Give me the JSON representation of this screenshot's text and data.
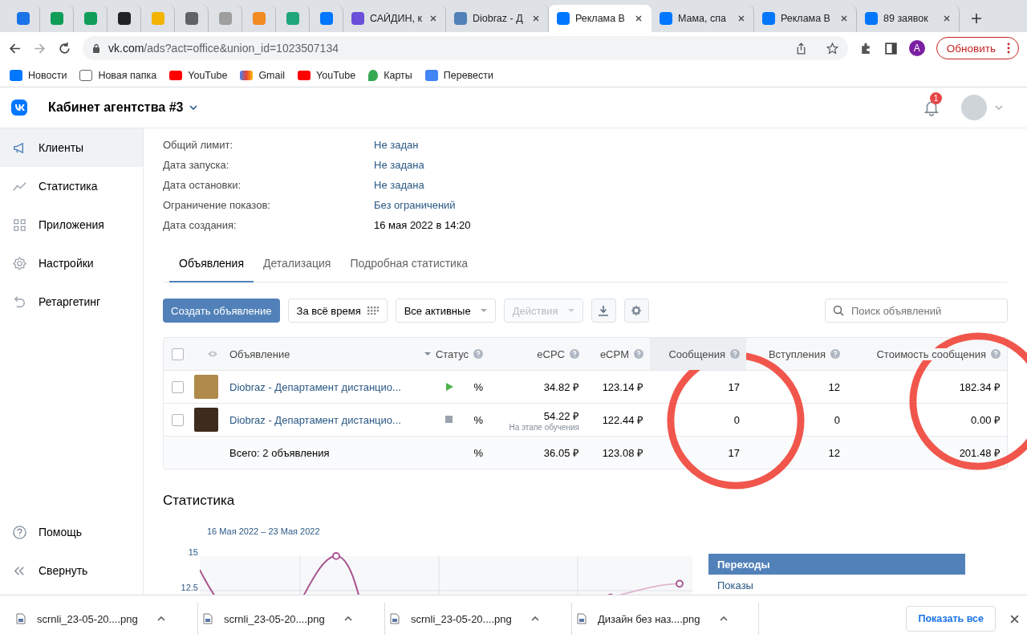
{
  "browser": {
    "tabs": [
      {
        "kind": "icon",
        "color": "#1a73e8",
        "selected": false
      },
      {
        "kind": "icon",
        "color": "#0f9d58",
        "selected": false
      },
      {
        "kind": "icon",
        "color": "#0f9d58",
        "selected": false
      },
      {
        "kind": "icon",
        "color": "#202124",
        "selected": false
      },
      {
        "kind": "icon",
        "color": "#f2b400",
        "selected": false
      },
      {
        "kind": "icon",
        "color": "#5f6368",
        "selected": false
      },
      {
        "kind": "icon",
        "color": "#9e9e9e",
        "selected": false
      },
      {
        "kind": "icon",
        "color": "#f28b22",
        "selected": false
      },
      {
        "kind": "icon",
        "color": "#1fa67a",
        "selected": false
      },
      {
        "kind": "icon",
        "color": "#0077ff",
        "selected": false
      },
      {
        "kind": "titled",
        "color": "#6b4fd8",
        "label": "САЙДИН, к",
        "selected": false
      },
      {
        "kind": "titled",
        "color": "#5181b8",
        "label": "Diobraz - Д",
        "selected": false
      },
      {
        "kind": "titled",
        "color": "#0077ff",
        "label": "Реклама В",
        "selected": true
      },
      {
        "kind": "titled",
        "color": "#0077ff",
        "label": "Мама, спа",
        "selected": false
      },
      {
        "kind": "titled",
        "color": "#0077ff",
        "label": "Реклама В",
        "selected": false
      },
      {
        "kind": "titled",
        "color": "#0077ff",
        "label": "89 заявок",
        "selected": false
      }
    ],
    "url_host": "vk.com",
    "url_path": "/ads?act=office&union_id=1023507134",
    "profile_initial": "A",
    "update_button": "Обновить",
    "bookmarks": [
      {
        "kind": "vk",
        "label": "Новости"
      },
      {
        "kind": "folder",
        "label": "Новая папка"
      },
      {
        "kind": "youtube",
        "label": "YouTube"
      },
      {
        "kind": "gmail",
        "label": "Gmail"
      },
      {
        "kind": "youtube",
        "label": "YouTube"
      },
      {
        "kind": "maps",
        "label": "Карты"
      },
      {
        "kind": "translate",
        "label": "Перевести"
      }
    ]
  },
  "header": {
    "title": "Кабинет агентства #3",
    "notifications": "1"
  },
  "sidebar": {
    "items": [
      {
        "kind": "megaphone",
        "label": "Клиенты",
        "selected": true
      },
      {
        "kind": "chart",
        "label": "Статистика",
        "selected": false
      },
      {
        "kind": "apps",
        "label": "Приложения",
        "selected": false
      },
      {
        "kind": "gear",
        "label": "Настройки",
        "selected": false
      },
      {
        "kind": "retarget",
        "label": "Ретаргетинг",
        "selected": false
      }
    ],
    "footer": [
      {
        "kind": "help",
        "label": "Помощь"
      },
      {
        "kind": "collapse",
        "label": "Свернуть"
      }
    ]
  },
  "details": [
    {
      "label": "Общий лимит:",
      "value": "Не задан",
      "kind": "link"
    },
    {
      "label": "Дата запуска:",
      "value": "Не задана",
      "kind": "link"
    },
    {
      "label": "Дата остановки:",
      "value": "Не задана",
      "kind": "link"
    },
    {
      "label": "Ограничение показов:",
      "value": "Без ограничений",
      "kind": "link"
    },
    {
      "label": "Дата создания:",
      "value": "16 мая 2022 в 14:20",
      "kind": "text"
    }
  ],
  "tabs": [
    {
      "label": "Объявления",
      "selected": true
    },
    {
      "label": "Детализация",
      "selected": false
    },
    {
      "label": "Подробная статистика",
      "selected": false
    }
  ],
  "toolbar": {
    "create_button": "Создать объявление",
    "period_button": "За всё время",
    "filter_dropdown": "Все активные",
    "actions_dropdown": {
      "label": "Действия",
      "disabled": true
    },
    "search_placeholder": "Поиск объявлений"
  },
  "table": {
    "select_all_checked": false,
    "columns": [
      {
        "label": "Объявление",
        "help": false
      },
      {
        "label": "Статус",
        "help": true
      },
      {
        "label": "eCPC",
        "help": true
      },
      {
        "label": "eCPM",
        "help": true
      },
      {
        "label": "Сообщения",
        "help": true
      },
      {
        "label": "Вступления",
        "help": true
      },
      {
        "label": "Стоимость сообщения",
        "help": true
      }
    ],
    "rows": [
      {
        "checked": false,
        "name": "Diobraz - Департамент дистанцио...",
        "kind": "running",
        "share": "%",
        "ecpc": "34.82 ₽",
        "ecpm": "123.14 ₽",
        "messages": "17",
        "joins": "12",
        "cost": "182.34 ₽"
      },
      {
        "checked": false,
        "name": "Diobraz - Департамент дистанцио...",
        "kind": "stopped",
        "share": "%",
        "ecpc": "54.22 ₽",
        "ecpc_note": "На этапе обучения",
        "ecpm": "122.44 ₽",
        "messages": "0",
        "joins": "0",
        "cost": "0.00 ₽"
      }
    ],
    "total": {
      "label": "Всего: 2 объявления",
      "share": "%",
      "ecpc": "36.05 ₽",
      "ecpm": "123.08 ₽",
      "messages": "17",
      "joins": "12",
      "cost": "201.48 ₽"
    }
  },
  "statistics": {
    "title": "Статистика",
    "date_range": "16 Мая 2022 – 23 Мая 2022",
    "y_labels": [
      "15",
      "12.5"
    ],
    "legend": [
      {
        "label": "Переходы",
        "selected": true
      },
      {
        "label": "Показы",
        "selected": false
      }
    ]
  },
  "annotations": [
    {
      "kind": "circle"
    },
    {
      "kind": "circle"
    }
  ],
  "downloads": {
    "files": [
      {
        "name": "scrnli_23-05-20....png"
      },
      {
        "name": "scrnli_23-05-20....png"
      },
      {
        "name": "scrnli_23-05-20....png"
      },
      {
        "name": "Дизайн без наз....png"
      }
    ],
    "show_all": "Показать все"
  }
}
